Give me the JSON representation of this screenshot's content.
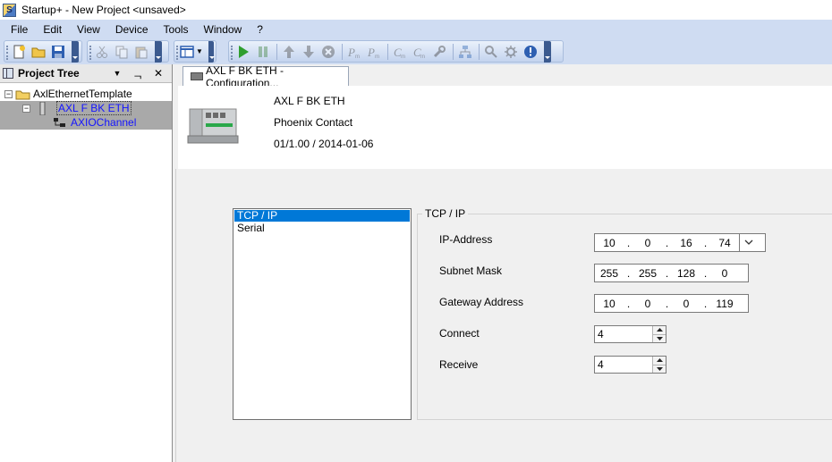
{
  "window": {
    "title": "Startup+ - New Project  <unsaved>",
    "app_icon": "S"
  },
  "menu": [
    "File",
    "Edit",
    "View",
    "Device",
    "Tools",
    "Window",
    "?"
  ],
  "toolbar": {
    "icons": [
      "new-project-icon",
      "open-folder-icon",
      "save-icon",
      "cut-icon",
      "copy-icon",
      "paste-icon",
      "view-layout-icon",
      "play-icon",
      "pause-icon",
      "arrow-up-icon",
      "arrow-down-icon",
      "stop-icon",
      "parameter-icon",
      "parameter-alt-icon",
      "connect-icon",
      "disconnect-icon",
      "wrench-icon",
      "network-icon",
      "search-icon",
      "settings-icon",
      "info-icon"
    ]
  },
  "tree": {
    "header": "Project Tree",
    "pin_glyph": "ᆨ",
    "close_glyph": "✕",
    "dropdown_glyph": "▼",
    "nodes": [
      {
        "label": "AxlEthernetTemplate",
        "expander": "−"
      },
      {
        "label": "AXL F BK ETH",
        "expander": "−"
      },
      {
        "label": "AXIOChannel"
      }
    ]
  },
  "tab": {
    "label": "AXL F BK ETH - Configuration..."
  },
  "device": {
    "name": "AXL F BK ETH",
    "vendor": "Phoenix Contact",
    "version": "01/1.00 / 2014-01-06"
  },
  "categories": [
    "TCP / IP",
    "Serial"
  ],
  "tcp": {
    "group_label": "TCP / IP",
    "ip_label": "IP-Address",
    "ip": [
      "10",
      "0",
      "16",
      "74"
    ],
    "subnet_label": "Subnet Mask",
    "subnet": [
      "255",
      "255",
      "128",
      "0"
    ],
    "gateway_label": "Gateway Address",
    "gateway": [
      "10",
      "0",
      "0",
      "119"
    ],
    "connect_label": "Connect",
    "connect_value": "4",
    "receive_label": "Receive",
    "receive_value": "4"
  }
}
